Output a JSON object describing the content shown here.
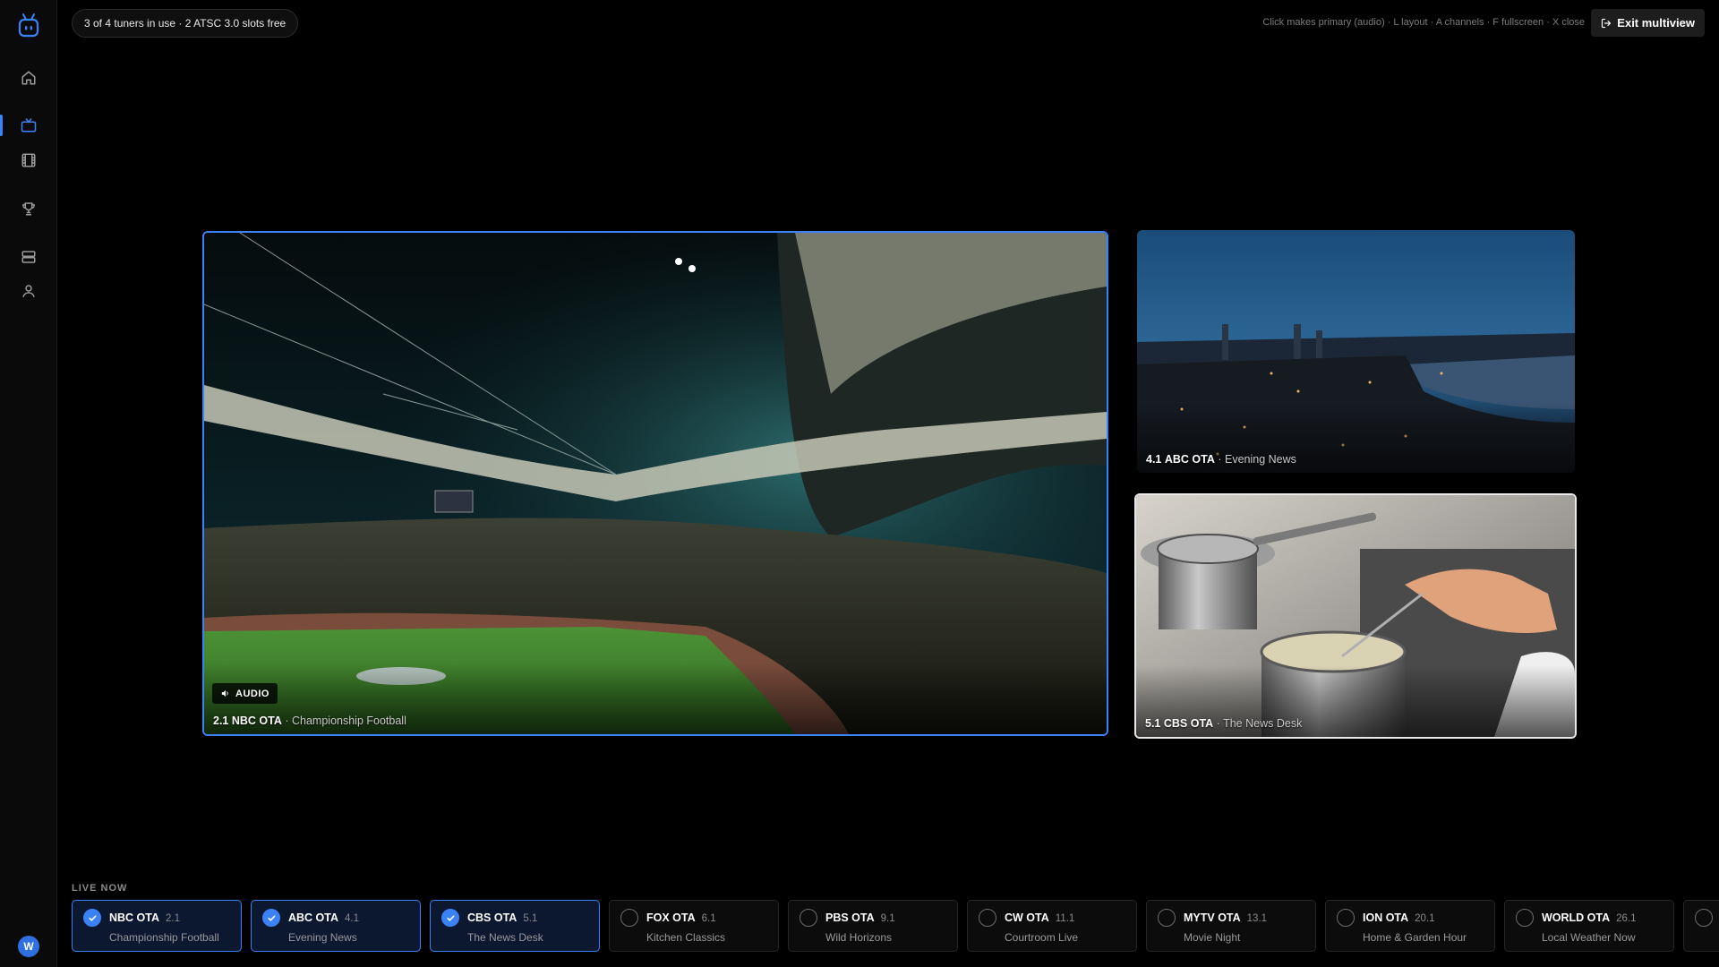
{
  "header": {
    "tuner_status": "3 of 4 tuners in use · 2 ATSC 3.0 slots free",
    "hint": "Click makes primary (audio) · L layout · A channels · F fullscreen · X close",
    "exit_label": "Exit multiview"
  },
  "sidebar": {
    "items": [
      {
        "icon": "home-icon",
        "active": false
      },
      {
        "icon": "tv-icon",
        "active": true
      },
      {
        "icon": "film-icon",
        "active": false
      },
      {
        "icon": "trophy-icon",
        "active": false
      },
      {
        "icon": "server-icon",
        "active": false
      },
      {
        "icon": "user-icon",
        "active": false
      }
    ],
    "avatar_initial": "W"
  },
  "tiles": {
    "primary": {
      "number": "2.1",
      "name": "NBC OTA",
      "show": "Championship Football",
      "audio_label": "AUDIO"
    },
    "secondary1": {
      "number": "4.1",
      "name": "ABC OTA",
      "show": "Evening News"
    },
    "secondary2": {
      "number": "5.1",
      "name": "CBS OTA",
      "show": "The News Desk"
    }
  },
  "live_now": {
    "title": "LIVE NOW",
    "channels": [
      {
        "name": "NBC OTA",
        "number": "2.1",
        "show": "Championship Football",
        "selected": true
      },
      {
        "name": "ABC OTA",
        "number": "4.1",
        "show": "Evening News",
        "selected": true
      },
      {
        "name": "CBS OTA",
        "number": "5.1",
        "show": "The News Desk",
        "selected": true
      },
      {
        "name": "FOX OTA",
        "number": "6.1",
        "show": "Kitchen Classics",
        "selected": false
      },
      {
        "name": "PBS OTA",
        "number": "9.1",
        "show": "Wild Horizons",
        "selected": false
      },
      {
        "name": "CW OTA",
        "number": "11.1",
        "show": "Courtroom Live",
        "selected": false
      },
      {
        "name": "MYTV OTA",
        "number": "13.1",
        "show": "Movie Night",
        "selected": false
      },
      {
        "name": "ION OTA",
        "number": "20.1",
        "show": "Home & Garden Hour",
        "selected": false
      },
      {
        "name": "WORLD OTA",
        "number": "26.1",
        "show": "Local Weather Now",
        "selected": false
      },
      {
        "name": "",
        "number": "",
        "show": "",
        "selected": false
      }
    ]
  },
  "colors": {
    "accent": "#3b82f6",
    "background": "#000000"
  }
}
